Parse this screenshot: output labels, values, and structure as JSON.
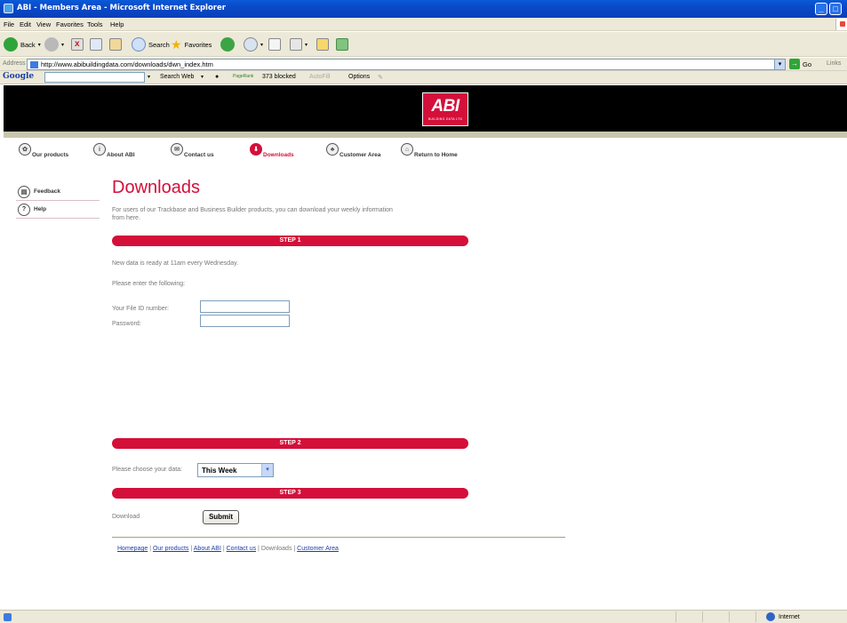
{
  "window": {
    "title": "ABI - Members Area - Microsoft Internet Explorer"
  },
  "menu": [
    "File",
    "Edit",
    "View",
    "Favorites",
    "Tools",
    "Help"
  ],
  "toolbar": {
    "back": "Back",
    "search": "Search",
    "favorites": "Favorites"
  },
  "address": {
    "label": "Address",
    "url": "http://www.abibuildingdata.com/downloads/dwn_index.htm",
    "go": "Go",
    "links": "Links"
  },
  "google_toolbar": {
    "logo": "Google",
    "search_web": "Search Web",
    "pagerank": "PageRank",
    "blocked": "373 blocked",
    "autofill": "AutoFill",
    "options": "Options"
  },
  "site": {
    "logo_text": "ABI",
    "logo_sub": "BUILDING DATA LTD",
    "nav": [
      {
        "label": "Our products",
        "active": false
      },
      {
        "label": "About ABI",
        "active": false
      },
      {
        "label": "Contact us",
        "active": false
      },
      {
        "label": "Downloads",
        "active": true
      },
      {
        "label": "Customer Area",
        "active": false
      },
      {
        "label": "Return to Home",
        "active": false
      }
    ],
    "sidebar": [
      {
        "label": "Feedback"
      },
      {
        "label": "Help"
      }
    ]
  },
  "content": {
    "heading": "Downloads",
    "intro": "For users of our Trackbase and Business Builder products, you can download your weekly information from here.",
    "step1": "STEP 1",
    "ready": "New data is ready at 11am every Wednesday.",
    "enter": "Please enter the following:",
    "file_id_label": "Your File ID number:",
    "password_label": "Password:",
    "file_id_value": "",
    "password_value": "",
    "step2": "STEP 2",
    "choose_label": "Please choose your data:",
    "choose_value": "This Week",
    "step3": "STEP 3",
    "download_label": "Download",
    "submit": "Submit"
  },
  "footer": [
    {
      "label": "Homepage",
      "link": true
    },
    {
      "label": "Our products",
      "link": true
    },
    {
      "label": "About ABI",
      "link": true
    },
    {
      "label": "Contact us",
      "link": true
    },
    {
      "label": "Downloads",
      "link": false
    },
    {
      "label": "Customer Area",
      "link": true
    }
  ],
  "status": {
    "zone": "Internet"
  }
}
